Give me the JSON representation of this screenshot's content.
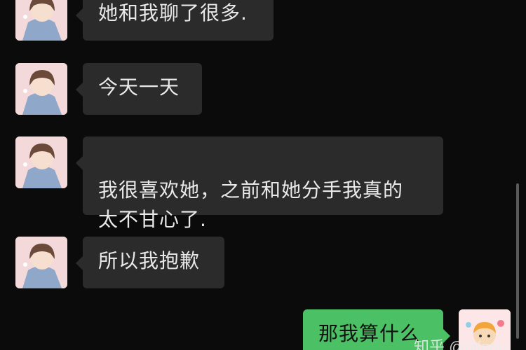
{
  "messages": [
    {
      "side": "in",
      "text": "她和我聊了很多.",
      "avatar": "girl-avatar"
    },
    {
      "side": "in",
      "text": "今天一天",
      "avatar": "girl-avatar"
    },
    {
      "side": "in",
      "text": "我很喜欢她，之前和她分手我真的\n太不甘心了.",
      "avatar": "girl-avatar"
    },
    {
      "side": "in",
      "text": "所以我抱歉",
      "avatar": "girl-avatar"
    },
    {
      "side": "out",
      "text": "那我算什么",
      "avatar": "cartoon-avatar"
    }
  ],
  "watermark": "知乎 @bjfggu",
  "colors": {
    "background": "#0b0b0b",
    "incoming_bubble": "#2b2b2b",
    "outgoing_bubble": "#4cc064"
  }
}
